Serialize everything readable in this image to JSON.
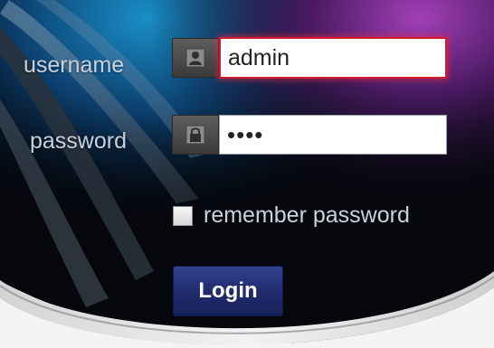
{
  "login_form": {
    "username_label": "username",
    "password_label": "password",
    "username_value": "admin",
    "password_value": "1234",
    "remember_label": "remember password",
    "remember_checked": false,
    "login_button_label": "Login"
  },
  "icons": {
    "username": "user-icon",
    "password": "lock-icon"
  },
  "colors": {
    "accent_button": "#1f2a6d",
    "focus_border": "#d21a2c",
    "label_text": "#c9d2dc"
  }
}
